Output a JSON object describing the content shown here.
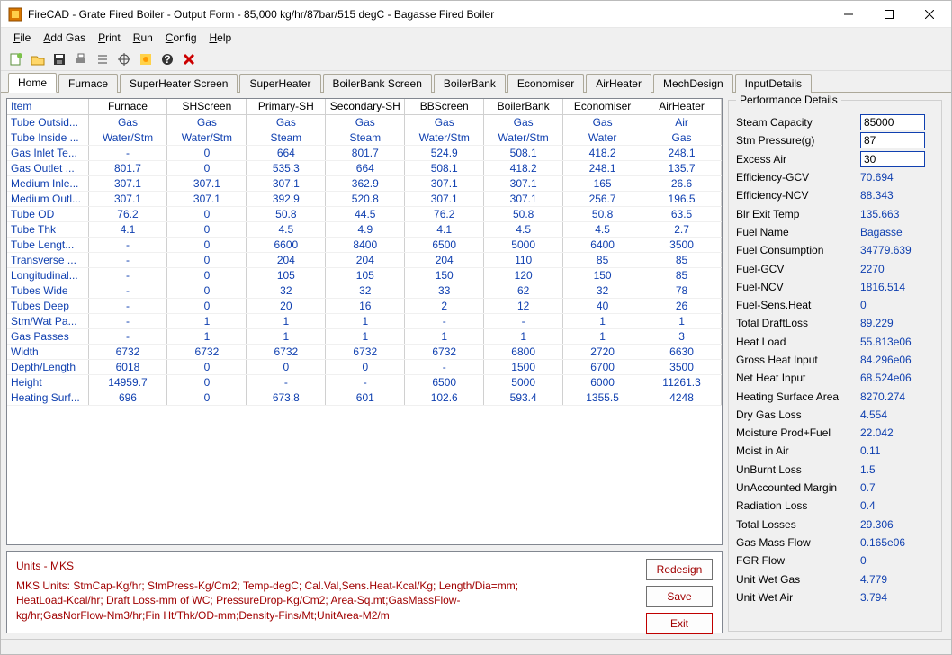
{
  "window": {
    "title": "FireCAD - Grate Fired Boiler - Output Form - 85,000 kg/hr/87bar/515 degC - Bagasse Fired Boiler"
  },
  "menu": {
    "file": "File",
    "addgas": "Add Gas",
    "print": "Print",
    "run": "Run",
    "config": "Config",
    "help": "Help"
  },
  "tabs": [
    "Home",
    "Furnace",
    "SuperHeater Screen",
    "SuperHeater",
    "BoilerBank Screen",
    "BoilerBank",
    "Economiser",
    "AirHeater",
    "MechDesign",
    "InputDetails"
  ],
  "grid": {
    "headers": [
      "Item",
      "Furnace",
      "SHScreen",
      "Primary-SH",
      "Secondary-SH",
      "BBScreen",
      "BoilerBank",
      "Economiser",
      "AirHeater"
    ],
    "rows": [
      [
        "Tube Outsid...",
        "Gas",
        "Gas",
        "Gas",
        "Gas",
        "Gas",
        "Gas",
        "Gas",
        "Air"
      ],
      [
        "Tube Inside ...",
        "Water/Stm",
        "Water/Stm",
        "Steam",
        "Steam",
        "Water/Stm",
        "Water/Stm",
        "Water",
        "Gas"
      ],
      [
        "Gas Inlet Te...",
        "-",
        "0",
        "664",
        "801.7",
        "524.9",
        "508.1",
        "418.2",
        "248.1"
      ],
      [
        "Gas Outlet ...",
        "801.7",
        "0",
        "535.3",
        "664",
        "508.1",
        "418.2",
        "248.1",
        "135.7"
      ],
      [
        "Medium Inle...",
        "307.1",
        "307.1",
        "307.1",
        "362.9",
        "307.1",
        "307.1",
        "165",
        "26.6"
      ],
      [
        "Medium Outl...",
        "307.1",
        "307.1",
        "392.9",
        "520.8",
        "307.1",
        "307.1",
        "256.7",
        "196.5"
      ],
      [
        "Tube OD",
        "76.2",
        "0",
        "50.8",
        "44.5",
        "76.2",
        "50.8",
        "50.8",
        "63.5"
      ],
      [
        "Tube Thk",
        "4.1",
        "0",
        "4.5",
        "4.9",
        "4.1",
        "4.5",
        "4.5",
        "2.7"
      ],
      [
        "Tube Lengt...",
        "-",
        "0",
        "6600",
        "8400",
        "6500",
        "5000",
        "6400",
        "3500"
      ],
      [
        "Transverse ...",
        "-",
        "0",
        "204",
        "204",
        "204",
        "110",
        "85",
        "85"
      ],
      [
        "Longitudinal...",
        "-",
        "0",
        "105",
        "105",
        "150",
        "120",
        "150",
        "85"
      ],
      [
        "Tubes Wide",
        "-",
        "0",
        "32",
        "32",
        "33",
        "62",
        "32",
        "78"
      ],
      [
        "Tubes Deep",
        "-",
        "0",
        "20",
        "16",
        "2",
        "12",
        "40",
        "26"
      ],
      [
        "Stm/Wat Pa...",
        "-",
        "1",
        "1",
        "1",
        "-",
        "-",
        "1",
        "1"
      ],
      [
        "Gas Passes",
        "-",
        "1",
        "1",
        "1",
        "1",
        "1",
        "1",
        "3"
      ],
      [
        "Width",
        "6732",
        "6732",
        "6732",
        "6732",
        "6732",
        "6800",
        "2720",
        "6630"
      ],
      [
        "Depth/Length",
        "6018",
        "0",
        "0",
        "0",
        "-",
        "1500",
        "6700",
        "3500"
      ],
      [
        "Height",
        "14959.7",
        "0",
        "-",
        "-",
        "6500",
        "5000",
        "6000",
        "11261.3"
      ],
      [
        "Heating Surf...",
        "696",
        "0",
        "673.8",
        "601",
        "102.6",
        "593.4",
        "1355.5",
        "4248"
      ]
    ]
  },
  "units": {
    "title": "Units - MKS",
    "body": "MKS Units: StmCap-Kg/hr; StmPress-Kg/Cm2; Temp-degC; Cal.Val,Sens.Heat-Kcal/Kg; Length/Dia=mm; HeatLoad-Kcal/hr; Draft Loss-mm of WC; PressureDrop-Kg/Cm2; Area-Sq.mt;GasMassFlow-kg/hr;GasNorFlow-Nm3/hr;Fin Ht/Thk/OD-mm;Density-Fins/Mt;UnitArea-M2/m"
  },
  "buttons": {
    "redesign": "Redesign",
    "save": "Save",
    "exit": "Exit"
  },
  "perf": {
    "title": "Performance Details",
    "inputs": [
      {
        "label": "Steam Capacity",
        "value": "85000"
      },
      {
        "label": "Stm Pressure(g)",
        "value": "87"
      },
      {
        "label": "Excess Air",
        "value": "30"
      }
    ],
    "rows": [
      {
        "label": "Efficiency-GCV",
        "value": "70.694"
      },
      {
        "label": "Efficiency-NCV",
        "value": "88.343"
      },
      {
        "label": "Blr Exit Temp",
        "value": "135.663"
      },
      {
        "label": "Fuel Name",
        "value": "Bagasse"
      },
      {
        "label": "Fuel Consumption",
        "value": "34779.639"
      },
      {
        "label": "Fuel-GCV",
        "value": "2270"
      },
      {
        "label": "Fuel-NCV",
        "value": "1816.514"
      },
      {
        "label": "Fuel-Sens.Heat",
        "value": "0"
      },
      {
        "label": "Total DraftLoss",
        "value": "89.229"
      },
      {
        "label": "Heat Load",
        "value": "55.813e06"
      },
      {
        "label": "Gross Heat Input",
        "value": "84.296e06"
      },
      {
        "label": "Net Heat Input",
        "value": "68.524e06"
      },
      {
        "label": "Heating Surface Area",
        "value": "8270.274"
      },
      {
        "label": "Dry Gas Loss",
        "value": "4.554"
      },
      {
        "label": "Moisture Prod+Fuel",
        "value": "22.042"
      },
      {
        "label": "Moist in Air",
        "value": "0.11"
      },
      {
        "label": "UnBurnt Loss",
        "value": "1.5"
      },
      {
        "label": "UnAccounted Margin",
        "value": "0.7"
      },
      {
        "label": "Radiation Loss",
        "value": "0.4"
      },
      {
        "label": "Total Losses",
        "value": "29.306"
      },
      {
        "label": "Gas Mass Flow",
        "value": "0.165e06"
      },
      {
        "label": "FGR Flow",
        "value": "0"
      },
      {
        "label": "Unit Wet Gas",
        "value": "4.779"
      },
      {
        "label": "Unit Wet Air",
        "value": "3.794"
      }
    ]
  }
}
